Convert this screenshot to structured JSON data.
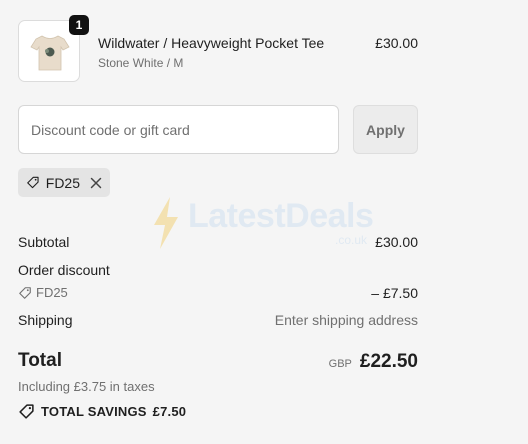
{
  "product": {
    "quantity": "1",
    "name": "Wildwater / Heavyweight Pocket Tee",
    "variant": "Stone White / M",
    "price": "£30.00"
  },
  "discount": {
    "placeholder": "Discount code or gift card",
    "apply_label": "Apply",
    "applied_code": "FD25"
  },
  "watermark": {
    "text": "LatestDeals",
    "sub": ".co.uk"
  },
  "summary": {
    "subtotal_label": "Subtotal",
    "subtotal_value": "£30.00",
    "order_discount_label": "Order discount",
    "discount_code": "FD25",
    "discount_value": "– £7.50",
    "shipping_label": "Shipping",
    "shipping_value": "Enter shipping address",
    "total_label": "Total",
    "currency": "GBP",
    "total_value": "£22.50",
    "taxes_note": "Including £3.75 in taxes",
    "savings_label": "TOTAL SAVINGS",
    "savings_value": "£7.50"
  },
  "icons": {
    "tag": "tag-icon",
    "close": "close-icon",
    "bolt": "bolt-icon",
    "tshirt": "tshirt-icon"
  }
}
